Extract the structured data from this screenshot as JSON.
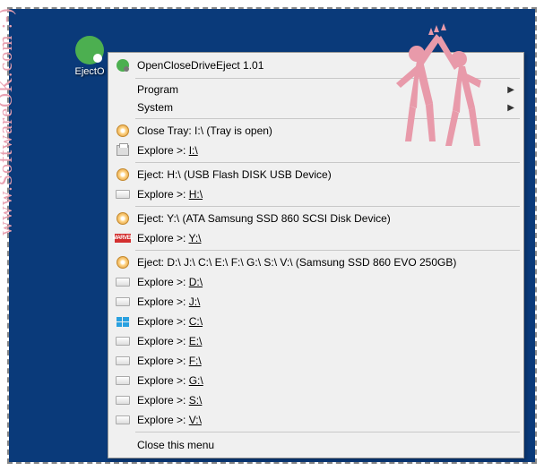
{
  "desktop": {
    "icon_label": "EjectO"
  },
  "watermark": "www.SoftwareOK.com :-)",
  "menu": {
    "title": "OpenCloseDriveEject 1.01",
    "program": "Program",
    "system": "System",
    "drives": [
      {
        "close_tray": "Close Tray: I:\\ (Tray is open)",
        "explore": "Explore >: ",
        "explore_letter": "I:\\"
      },
      {
        "eject": "Eject: H:\\  (USB Flash DISK USB Device)",
        "explore": "Explore >: ",
        "explore_letter": "H:\\"
      },
      {
        "eject": "Eject: Y:\\  (ATA Samsung SSD 860 SCSI Disk Device)",
        "explore": "Explore >: ",
        "explore_letter": "Y:\\"
      },
      {
        "eject": "Eject: D:\\ J:\\ C:\\ E:\\ F:\\ G:\\ S:\\ V:\\  (Samsung SSD 860 EVO 250GB)",
        "explores": [
          {
            "pre": "Explore >: ",
            "letter": "D:\\"
          },
          {
            "pre": "Explore >: ",
            "letter": "J:\\"
          },
          {
            "pre": "Explore >: ",
            "letter": "C:\\"
          },
          {
            "pre": "Explore >: ",
            "letter": "E:\\"
          },
          {
            "pre": "Explore >: ",
            "letter": "F:\\"
          },
          {
            "pre": "Explore >: ",
            "letter": "G:\\"
          },
          {
            "pre": "Explore >: ",
            "letter": "S:\\"
          },
          {
            "pre": "Explore >: ",
            "letter": "V:\\"
          }
        ]
      }
    ],
    "close": "Close this menu"
  },
  "marvel_abbr": "MARVEL"
}
